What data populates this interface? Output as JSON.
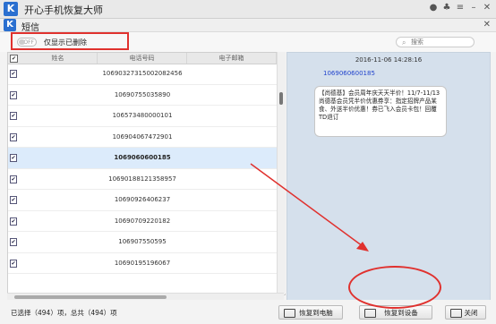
{
  "app": {
    "title": "开心手机恢复大师",
    "icon_letter": "K"
  },
  "dialog": {
    "title": "短信",
    "icon_letter": "K"
  },
  "toolbar": {
    "toggle_state": "OFF",
    "toggle_label": "仅显示已删除",
    "search_placeholder": "搜索"
  },
  "table": {
    "columns": [
      "姓名",
      "电话号码",
      "电子邮箱"
    ],
    "rows": [
      {
        "phone": "10690327315002082456",
        "checked": true,
        "selected": false
      },
      {
        "phone": "10690755035890",
        "checked": true,
        "selected": false
      },
      {
        "phone": "106573480000101",
        "checked": true,
        "selected": false
      },
      {
        "phone": "106904067472901",
        "checked": true,
        "selected": false
      },
      {
        "phone": "1069060600185",
        "checked": true,
        "selected": true
      },
      {
        "phone": "10690188121358957",
        "checked": true,
        "selected": false
      },
      {
        "phone": "10690926406237",
        "checked": true,
        "selected": false
      },
      {
        "phone": "10690709220182",
        "checked": true,
        "selected": false
      },
      {
        "phone": "106907550595",
        "checked": true,
        "selected": false
      },
      {
        "phone": "10690195196067",
        "checked": true,
        "selected": false
      }
    ]
  },
  "message": {
    "date": "2016-11-06 14:28:16",
    "sender": "1069060600185",
    "text": "【尚德基】会员周年庆天天半价！11/7-11/13尚德基会员凭半价优惠券享：指定招牌产品某食、外送半价优惠！券已飞入会员卡包！回覆TD退订"
  },
  "footer": {
    "selection_text": "已选择（494）项，总共（494）项",
    "btn_restore_pc": "恢复到电脑",
    "btn_restore_device": "恢复到设备",
    "btn_close": "关闭"
  },
  "colors": {
    "accent": "#2a6fd0",
    "annotation": "#e0312e",
    "pane_bg": "#d5e0ec",
    "selected_row": "#dcebfb"
  }
}
